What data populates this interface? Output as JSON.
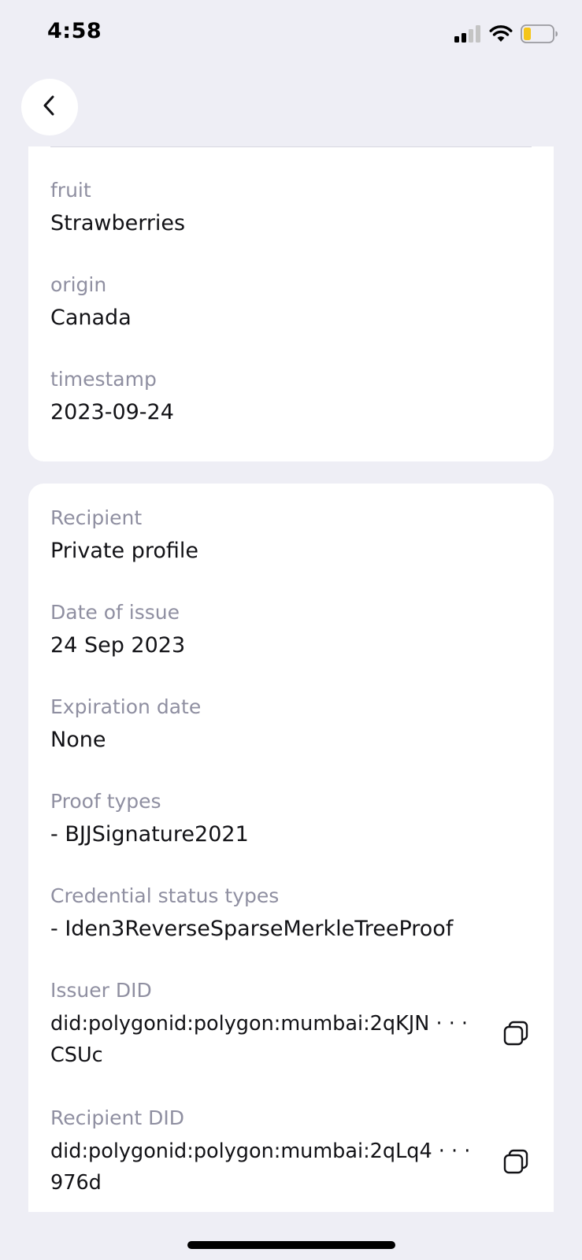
{
  "status_bar": {
    "time": "4:58"
  },
  "icons": {
    "signal": "cellular-signal-icon",
    "wifi": "wifi-icon",
    "battery": "battery-low-icon",
    "back": "chevron-left-icon",
    "copy": "copy-icon"
  },
  "claim_attributes": [
    {
      "label": "fruit",
      "value": "Strawberries"
    },
    {
      "label": "origin",
      "value": "Canada"
    },
    {
      "label": "timestamp",
      "value": "2023-09-24"
    }
  ],
  "credential_details": {
    "recipient": {
      "label": "Recipient",
      "value": "Private profile"
    },
    "date_of_issue": {
      "label": "Date of issue",
      "value": "24 Sep 2023"
    },
    "expiration_date": {
      "label": "Expiration date",
      "value": "None"
    },
    "proof_types": {
      "label": "Proof types",
      "value": "- BJJSignature2021"
    },
    "credential_status_types": {
      "label": "Credential status types",
      "value": "- Iden3ReverseSparseMerkleTreeProof"
    },
    "issuer_did": {
      "label": "Issuer DID",
      "value": "did:polygonid:polygon:mumbai:2qKJN · · · CSUc"
    },
    "recipient_did": {
      "label": "Recipient DID",
      "value": "did:polygonid:polygon:mumbai:2qLq4 · · · 976d"
    }
  },
  "colors": {
    "background": "#EEEEF5",
    "card": "#FFFFFF",
    "label": "#8F8FA1",
    "value": "#121216",
    "battery_fill": "#F5C518"
  }
}
